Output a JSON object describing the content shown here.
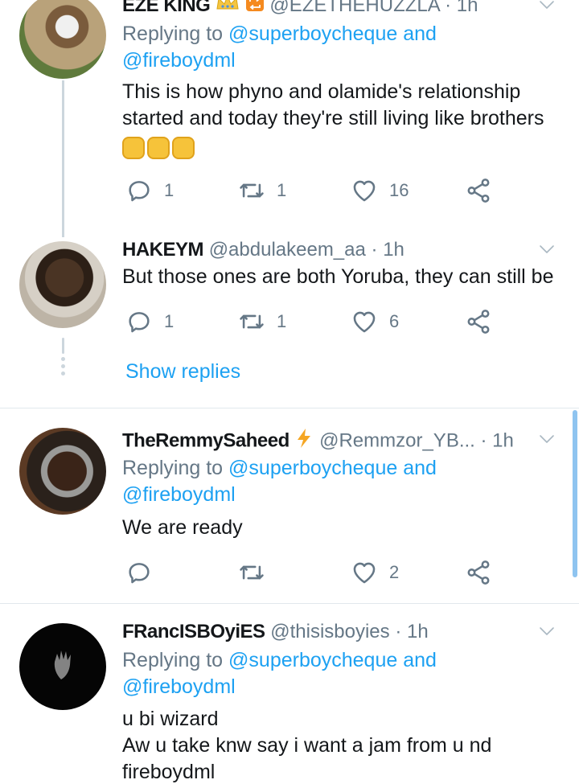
{
  "tweets": [
    {
      "name": "EZE KING",
      "handle": "@EZETHEHUZZLA",
      "time": "· 1h",
      "replying_prefix": "Replying to",
      "replying_1": "@superboycheque",
      "replying_and": "and",
      "replying_2": "@fireboydml",
      "text": "This is how phyno and olamide's relationship started and today they're still living like brothers",
      "emoji": "✊✊✊",
      "replies": "1",
      "retweets": "1",
      "likes": "16"
    },
    {
      "name": "HAKEYM",
      "handle": "@abdulakeem_aa",
      "time": "· 1h",
      "text": "But those ones are both Yoruba, they can still be",
      "replies": "1",
      "retweets": "1",
      "likes": "6"
    },
    {
      "name": "TheRemmySaheed",
      "handle": "@Remmzor_YB...",
      "time": "· 1h",
      "replying_prefix": "Replying to",
      "replying_1": "@superboycheque",
      "replying_and": "and",
      "replying_2": "@fireboydml",
      "text": "We are ready",
      "replies": "",
      "retweets": "",
      "likes": "2"
    },
    {
      "name": "FRancISBOyiES",
      "handle": "@thisisboyies",
      "time": "· 1h",
      "replying_prefix": "Replying to",
      "replying_1": "@superboycheque",
      "replying_and": "and",
      "replying_2": "@fireboydml",
      "text_line1": "u bi wizard",
      "text_line2": "Aw u take knw say i want a jam from u nd",
      "text_line3": "fireboydml"
    }
  ],
  "show_replies": "Show replies",
  "colors": {
    "link": "#1da1f2",
    "muted": "#657786",
    "thread": "#ccd6dd",
    "lightning": "#f5a623"
  }
}
